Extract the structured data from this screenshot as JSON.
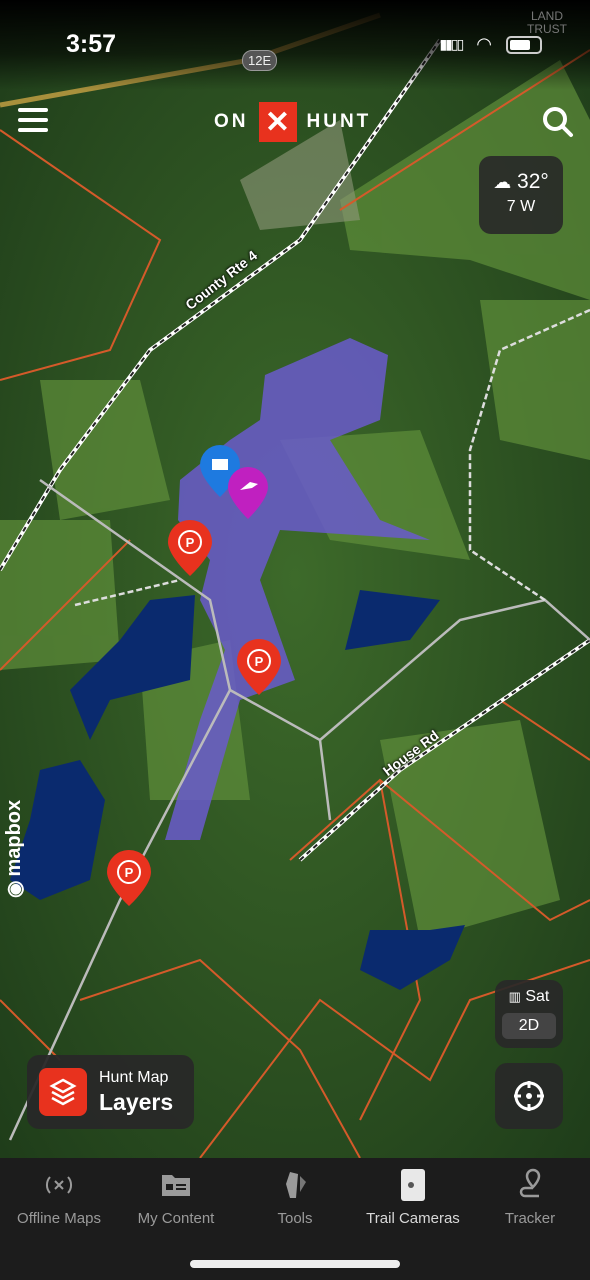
{
  "status_bar": {
    "time": "3:57"
  },
  "header": {
    "logo_left": "ON",
    "logo_mark": "✕",
    "logo_right": "HUNT"
  },
  "map": {
    "route_shield": "12E",
    "road_labels": [
      "County Rte 4",
      "House Rd"
    ],
    "corner_label": "LAND TRUST",
    "attribution": "mapbox",
    "colors": {
      "public_land": "#6a5acd",
      "blue_parcels": "#0a2a6e",
      "boundaries": "#d45a2a",
      "parking_pin": "#e8321e",
      "waypoint_pin": "#c020c0",
      "message_pin": "#1e7ae0"
    }
  },
  "weather": {
    "temp": "32°",
    "wind": "7 W",
    "icon": "cloud-icon"
  },
  "map_style": {
    "style": "Sat",
    "mode": "2D"
  },
  "layers_button": {
    "subtitle": "Hunt Map",
    "title": "Layers"
  },
  "tabs": [
    {
      "label": "Offline Maps",
      "icon": "offline-icon"
    },
    {
      "label": "My Content",
      "icon": "folder-icon"
    },
    {
      "label": "Tools",
      "icon": "tools-icon"
    },
    {
      "label": "Trail Cameras",
      "icon": "camera-icon",
      "active": true
    },
    {
      "label": "Tracker",
      "icon": "tracker-icon"
    }
  ]
}
